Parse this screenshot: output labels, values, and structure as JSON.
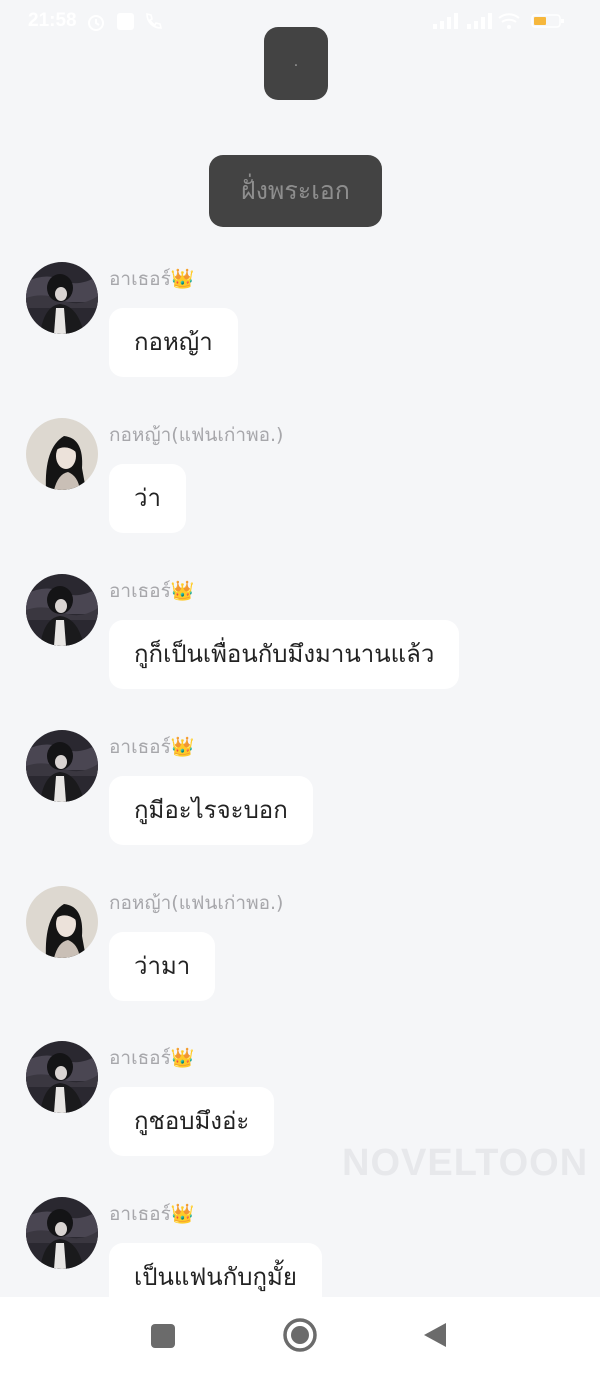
{
  "status_bar": {
    "time": "21:58",
    "battery_level": "4"
  },
  "top_badge": {
    "text": "."
  },
  "section_badge": {
    "text": "ฝั่งพระเอก"
  },
  "messages": [
    {
      "sender": "อาเธอร์👑",
      "text": "กอหญ้า",
      "avatar": "male"
    },
    {
      "sender": "กอหญ้า(แฟนเก่าพอ.)",
      "text": "ว่า",
      "avatar": "female"
    },
    {
      "sender": "อาเธอร์👑",
      "text": "กูก็เป็นเพื่อนกับมึงมานานแล้ว",
      "avatar": "male"
    },
    {
      "sender": "อาเธอร์👑",
      "text": "กูมีอะไรจะบอก",
      "avatar": "male"
    },
    {
      "sender": "กอหญ้า(แฟนเก่าพอ.)",
      "text": "ว่ามา",
      "avatar": "female"
    },
    {
      "sender": "อาเธอร์👑",
      "text": "กูชอบมึงอ่ะ",
      "avatar": "male"
    },
    {
      "sender": "อาเธอร์👑",
      "text": "เป็นแฟนกับกูมั้ย",
      "avatar": "male"
    }
  ],
  "watermark": "NOVELTOON",
  "nav_bar": {
    "icons": [
      "recent-apps-icon",
      "home-icon",
      "back-icon"
    ]
  },
  "colors": {
    "background": "#f5f6f8",
    "bubble": "#ffffff",
    "dark_badge": "#434343",
    "sender_text": "#a7a7ab",
    "battery_fill": "#f6b73c"
  }
}
